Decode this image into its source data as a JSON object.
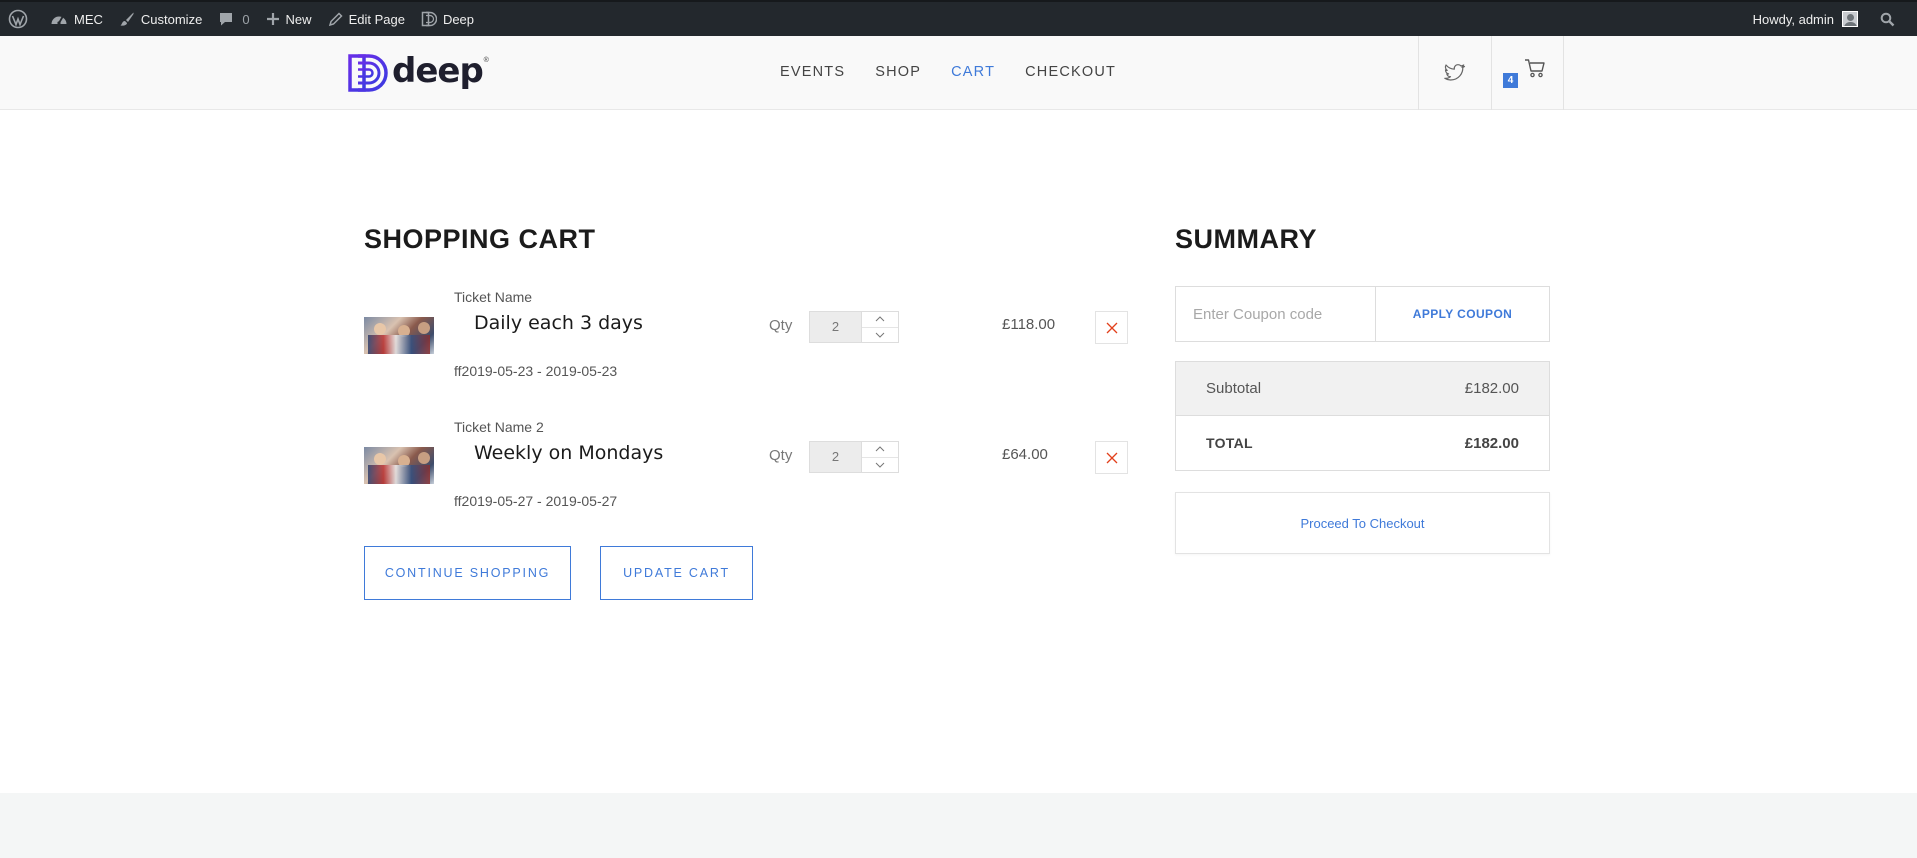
{
  "adminbar": {
    "site_name": "MEC",
    "customize": "Customize",
    "comments_count": "0",
    "new": "New",
    "edit_page": "Edit Page",
    "theme": "Deep",
    "howdy": "Howdy, admin"
  },
  "header": {
    "logo_text": "deep",
    "logo_reg": "®",
    "nav": [
      {
        "label": "EVENTS"
      },
      {
        "label": "SHOP"
      },
      {
        "label": "CART"
      },
      {
        "label": "CHECKOUT"
      }
    ],
    "active_nav": "CART",
    "cart_count": "4"
  },
  "cart": {
    "title": "SHOPPING CART",
    "qty_label": "Qty",
    "items": [
      {
        "ticket_label": "Ticket Name",
        "name": "Daily each 3 days",
        "date": "ff2019-05-23 - 2019-05-23",
        "qty": "2",
        "price": "£118.00"
      },
      {
        "ticket_label": "Ticket Name 2",
        "name": "Weekly on Mondays",
        "date": "ff2019-05-27 - 2019-05-27",
        "qty": "2",
        "price": "£64.00"
      }
    ],
    "continue_label": "CONTINUE SHOPPING",
    "update_label": "UPDATE CART"
  },
  "summary": {
    "title": "SUMMARY",
    "coupon_placeholder": "Enter Coupon code",
    "apply_label": "APPLY COUPON",
    "subtotal_label": "Subtotal",
    "subtotal_value": "£182.00",
    "total_label": "TOTAL",
    "total_value": "£182.00",
    "checkout_label": "Proceed To Checkout"
  },
  "colors": {
    "accent": "#3f7ad9",
    "adminbar": "#23282d",
    "remove_x": "#e2401c",
    "logo_purple": "#5b2be0"
  }
}
